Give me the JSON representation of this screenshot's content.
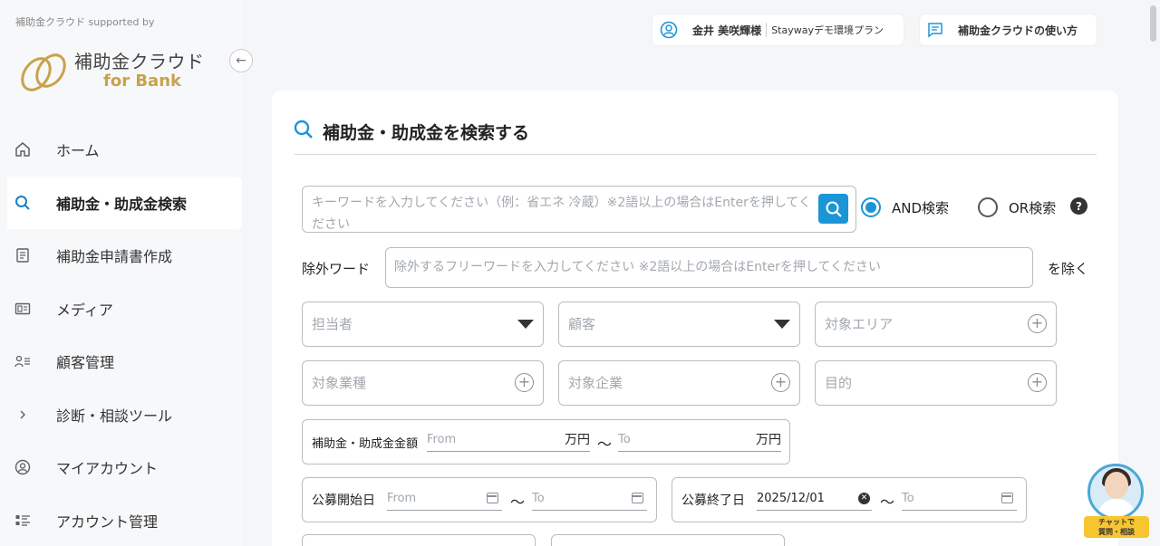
{
  "sidebar": {
    "supported_by": "補助金クラウド supported by",
    "logo_title": "補助金クラウド",
    "logo_sub": "for Bank",
    "items": [
      {
        "label": "ホーム",
        "icon": "home-icon"
      },
      {
        "label": "補助金・助成金検索",
        "icon": "search-icon",
        "active": true
      },
      {
        "label": "補助金申請書作成",
        "icon": "document-icon"
      },
      {
        "label": "メディア",
        "icon": "newspaper-icon"
      },
      {
        "label": "顧客管理",
        "icon": "users-list-icon"
      },
      {
        "label": "診断・相談ツール",
        "icon": "chevron-right-icon"
      },
      {
        "label": "マイアカウント",
        "icon": "user-circle-icon"
      },
      {
        "label": "アカウント管理",
        "icon": "list-icon"
      }
    ]
  },
  "header": {
    "user_name": "金井 美咲輝様",
    "plan": "Staywayデモ環境プラン",
    "help_label": "補助金クラウドの使い方"
  },
  "search": {
    "title": "補助金・助成金を検索する",
    "keyword_placeholder": "キーワードを入力してください（例：省エネ 冷蔵）※2語以上の場合はEnterを押してください",
    "and_label": "AND検索",
    "or_label": "OR検索",
    "exclude_label": "除外ワード",
    "exclude_placeholder": "除外するフリーワードを入力してください ※2語以上の場合はEnterを押してください",
    "exclude_suffix": "を除く",
    "tantousha": "担当者",
    "kokyaku": "顧客",
    "area": "対象エリア",
    "industry": "対象業種",
    "company": "対象企業",
    "purpose": "目的",
    "amount_label": "補助金・助成金金額",
    "from": "From",
    "to": "To",
    "unit": "万円",
    "tilde": "〜",
    "start_label": "公募開始日",
    "end_label": "公募終了日",
    "end_from_value": "2025/12/01"
  },
  "chat": {
    "line1": "チャットで",
    "line2": "質問・相談"
  },
  "colors": {
    "accent": "#1b95d6",
    "brand_gold": "#c9a24a"
  }
}
